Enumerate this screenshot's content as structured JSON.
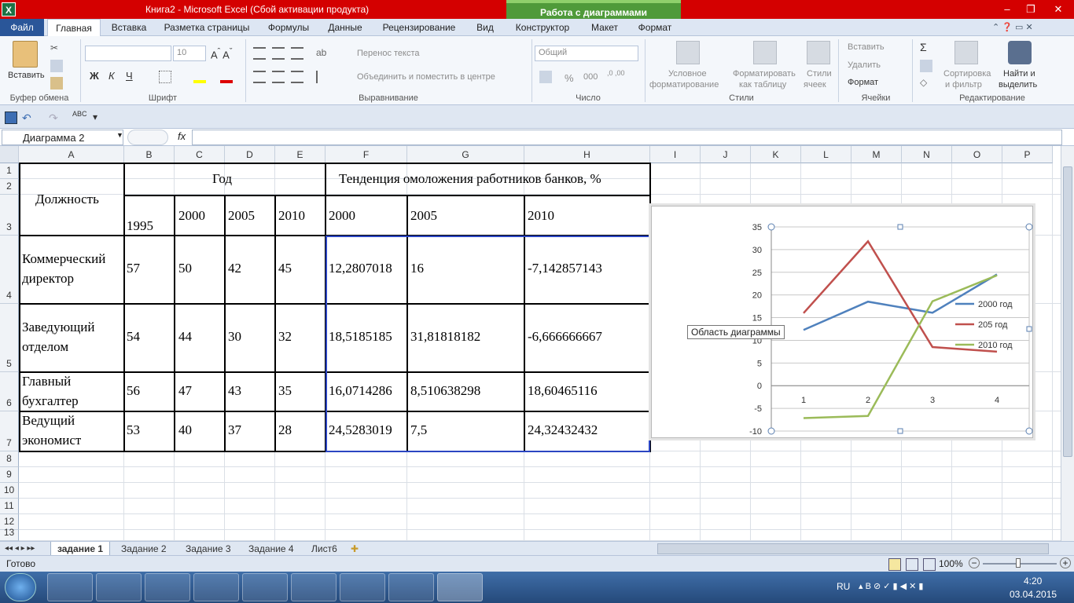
{
  "window": {
    "title": "Книга2  -  Microsoft Excel (Сбой активации продукта)",
    "context_header": "Работа с диаграммами",
    "minimize": "–",
    "restore": "❐",
    "close": "✕"
  },
  "ribbon_tabs": [
    "Файл",
    "Главная",
    "Вставка",
    "Разметка страницы",
    "Формулы",
    "Данные",
    "Рецензирование",
    "Вид",
    "Конструктор",
    "Макет",
    "Формат"
  ],
  "ribbon": {
    "clipboard": {
      "paste": "Вставить",
      "label": "Буфер обмена"
    },
    "font": {
      "name": "",
      "size": "10",
      "label": "Шрифт",
      "bold": "Ж",
      "italic": "К",
      "underline": "Ч"
    },
    "alignment": {
      "wrap": "Перенос текста",
      "merge": "Объединить и поместить в центре",
      "label": "Выравнивание"
    },
    "number": {
      "format": "Общий",
      "label": "Число",
      "percent": "%",
      "thousands": "000"
    },
    "styles": {
      "conditional": "Условное форматирование",
      "cond_l1": "Условное",
      "cond_l2": "форматирование",
      "table_l1": "Форматировать",
      "table_l2": "как таблицу",
      "cell_l1": "Стили",
      "cell_l2": "ячеек",
      "label": "Стили"
    },
    "cells": {
      "insert": "Вставить",
      "delete": "Удалить",
      "format": "Формат",
      "label": "Ячейки"
    },
    "editing": {
      "sum": "Σ",
      "sort_l1": "Сортировка",
      "sort_l2": "и фильтр",
      "find_l1": "Найти и",
      "find_l2": "выделить",
      "label": "Редактирование"
    }
  },
  "formula_bar": {
    "name_box": "Диаграмма 2",
    "fx": "fx",
    "formula": ""
  },
  "columns": [
    "A",
    "B",
    "C",
    "D",
    "E",
    "F",
    "G",
    "H",
    "I",
    "J",
    "K",
    "L",
    "M",
    "N",
    "O",
    "P"
  ],
  "rows": [
    "1",
    "2",
    "3",
    "4",
    "5",
    "6",
    "7",
    "8",
    "9",
    "10",
    "11",
    "12",
    "13"
  ],
  "table": {
    "header_position": "Должность",
    "header_year": "Год",
    "header_trend": "Тенденция омоложения работников банков, %",
    "years": [
      "1995",
      "2000",
      "2005",
      "2010"
    ],
    "trend_years": [
      "2000",
      "2005",
      "2010"
    ],
    "data": [
      {
        "pos_l1": "Коммерческий",
        "pos_l2": "директор",
        "vals": [
          "57",
          "50",
          "42",
          "45"
        ],
        "trend": [
          "12,2807018",
          "16",
          "-7,142857143"
        ]
      },
      {
        "pos_l1": "Заведующий",
        "pos_l2": "отделом",
        "vals": [
          "54",
          "44",
          "30",
          "32"
        ],
        "trend": [
          "18,5185185",
          "31,81818182",
          "-6,666666667"
        ]
      },
      {
        "pos_l1": "Главный",
        "pos_l2": "бухгалтер",
        "vals": [
          "56",
          "47",
          "43",
          "35"
        ],
        "trend": [
          "16,0714286",
          "8,510638298",
          "18,60465116"
        ]
      },
      {
        "pos_l1": "Ведущий",
        "pos_l2": "экономист",
        "vals": [
          "53",
          "40",
          "37",
          "28"
        ],
        "trend": [
          "24,5283019",
          "7,5",
          "24,32432432"
        ]
      }
    ]
  },
  "chart_data": {
    "type": "line",
    "x": [
      1,
      2,
      3,
      4
    ],
    "categories": [
      "1",
      "2",
      "3",
      "4"
    ],
    "ylim": [
      -10,
      35
    ],
    "yticks": [
      -10,
      -5,
      0,
      5,
      10,
      15,
      20,
      25,
      30,
      35
    ],
    "grid": true,
    "legend": "right",
    "series": [
      {
        "name": "2000 год",
        "values": [
          12.28,
          18.52,
          16.07,
          24.53
        ],
        "color": "#4f81bd"
      },
      {
        "name": "205 год",
        "values": [
          16,
          31.82,
          8.51,
          7.5
        ],
        "color": "#c0504d"
      },
      {
        "name": "2010 год",
        "values": [
          -7.14,
          -6.67,
          18.6,
          24.32
        ],
        "color": "#9bbb59"
      }
    ]
  },
  "chart_tooltip": "Область диаграммы",
  "sheet_tabs": [
    "задание 1",
    "Задание 2",
    "Задание 3",
    "Задание 4",
    "Лист6"
  ],
  "status": {
    "ready": "Готово",
    "zoom": "100%"
  },
  "taskbar": {
    "lang": "RU",
    "time": "4:20",
    "date": "03.04.2015"
  }
}
